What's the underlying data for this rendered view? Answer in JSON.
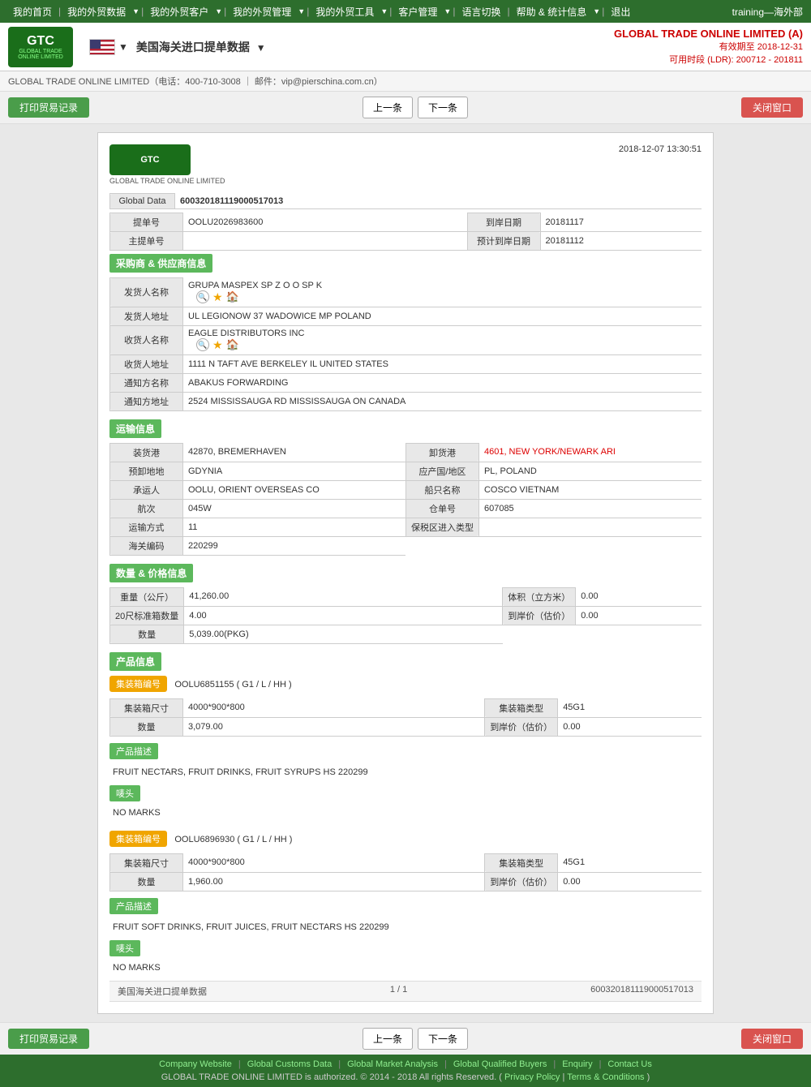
{
  "nav": {
    "items": [
      "我的首页",
      "我的外贸数据",
      "我的外贸客户",
      "我的外贸管理",
      "我的外贸工具",
      "客户管理",
      "语言切换",
      "帮助 & 统计信息",
      "退出"
    ],
    "user": "training—海外部"
  },
  "header": {
    "title": "美国海关进口提单数据",
    "flag_arrow": "▼",
    "company": "GLOBAL TRADE ONLINE LIMITED（电话：400-710-3008 ｜ 邮件：vip@pierschina.com.cn）",
    "company_right": "GLOBAL TRADE ONLINE LIMITED (A)",
    "valid_until": "有效期至 2018-12-31",
    "ldr": "可用时段 (LDR): 200712 - 201811"
  },
  "toolbar": {
    "print_label": "打印贸易记录",
    "prev_label": "上一条",
    "next_label": "下一条",
    "close_label": "关闭窗口"
  },
  "document": {
    "datetime": "2018-12-07 13:30:51",
    "logo_text": "GTC",
    "logo_sub": "GLOBAL TRADE ONLINE LIMITED",
    "global_data_label": "Global Data",
    "global_data_value": "600320181119000517013",
    "bill_no_label": "提单号",
    "bill_no_value": "OOLU2026983600",
    "arrival_date_label": "到岸日期",
    "arrival_date_value": "20181117",
    "master_bill_label": "主提单号",
    "master_bill_value": "",
    "eta_label": "预计到岸日期",
    "eta_value": "20181112"
  },
  "supplier": {
    "section_title": "采购商 & 供应商信息",
    "shipper_name_label": "发货人名称",
    "shipper_name_value": "GRUPA MASPEX SP Z O O SP K",
    "shipper_addr_label": "发货人地址",
    "shipper_addr_value": "UL LEGIONOW 37 WADOWICE MP POLAND",
    "consignee_name_label": "收货人名称",
    "consignee_name_value": "EAGLE DISTRIBUTORS INC",
    "consignee_addr_label": "收货人地址",
    "consignee_addr_value": "1111 N TAFT AVE BERKELEY IL UNITED STATES",
    "notify_name_label": "通知方名称",
    "notify_name_value": "ABAKUS FORWARDING",
    "notify_addr_label": "通知方地址",
    "notify_addr_value": "2524 MISSISSAUGA RD MISSISSAUGA ON CANADA"
  },
  "transport": {
    "section_title": "运输信息",
    "loading_port_label": "装货港",
    "loading_port_value": "42870, BREMERHAVEN",
    "discharge_port_label": "卸货港",
    "discharge_port_value": "4601, NEW YORK/NEWARK ARI",
    "pre_destination_label": "预卸地地",
    "pre_destination_value": "GDYNIA",
    "origin_country_label": "应产国/地区",
    "origin_country_value": "PL, POLAND",
    "carrier_label": "承运人",
    "carrier_value": "OOLU, ORIENT OVERSEAS CO",
    "vessel_name_label": "船只名称",
    "vessel_name_value": "COSCO VIETNAM",
    "voyage_label": "航次",
    "voyage_value": "045W",
    "bol_label": "仓单号",
    "bol_value": "607085",
    "transport_mode_label": "运输方式",
    "transport_mode_value": "11",
    "ftz_label": "保税区进入类型",
    "ftz_value": "",
    "customs_code_label": "海关编码",
    "customs_code_value": "220299"
  },
  "quantity": {
    "section_title": "数量 & 价格信息",
    "weight_label": "重量（公斤）",
    "weight_value": "41,260.00",
    "volume_label": "体积（立方米）",
    "volume_value": "0.00",
    "container_20ft_label": "20尺标准箱数量",
    "container_20ft_value": "4.00",
    "arrival_price_label": "到岸价（估价）",
    "arrival_price_value": "0.00",
    "qty_label": "数量",
    "qty_value": "5,039.00(PKG)"
  },
  "products": {
    "section_title": "产品信息",
    "items": [
      {
        "container_no_label": "集装箱编号",
        "container_no_value": "OOLU6851155 ( G1 / L / HH )",
        "container_size_label": "集装箱尺寸",
        "container_size_value": "4000*900*800",
        "container_type_label": "集装箱类型",
        "container_type_value": "45G1",
        "qty_label": "数量",
        "qty_value": "3,079.00",
        "price_label": "到岸价（估价）",
        "price_value": "0.00",
        "desc_title": "产品描述",
        "desc_value": "FRUIT NECTARS, FRUIT DRINKS, FRUIT SYRUPS HS 220299",
        "marks_title": "唛头",
        "marks_value": "NO MARKS"
      },
      {
        "container_no_label": "集装箱编号",
        "container_no_value": "OOLU6896930 ( G1 / L / HH )",
        "container_size_label": "集装箱尺寸",
        "container_size_value": "4000*900*800",
        "container_type_label": "集装箱类型",
        "container_type_value": "45G1",
        "qty_label": "数量",
        "qty_value": "1,960.00",
        "price_label": "到岸价（估价）",
        "price_value": "0.00",
        "desc_title": "产品描述",
        "desc_value": "FRUIT SOFT DRINKS, FRUIT JUICES, FRUIT NECTARS HS 220299",
        "marks_title": "唛头",
        "marks_value": "NO MARKS"
      }
    ]
  },
  "page_info": {
    "source_label": "美国海关进口提单数据",
    "pagination": "1 / 1",
    "record_id": "600320181119000517013"
  },
  "footer": {
    "links": [
      "Company Website",
      "Global Customs Data",
      "Global Market Analysis",
      "Global Qualified Buyers",
      "Enquiry",
      "Contact Us"
    ],
    "copyright": "GLOBAL TRADE ONLINE LIMITED is authorized. © 2014 - 2018 All rights Reserved.",
    "policy_links": [
      "Privacy Policy",
      "Terms & Conditions"
    ]
  }
}
